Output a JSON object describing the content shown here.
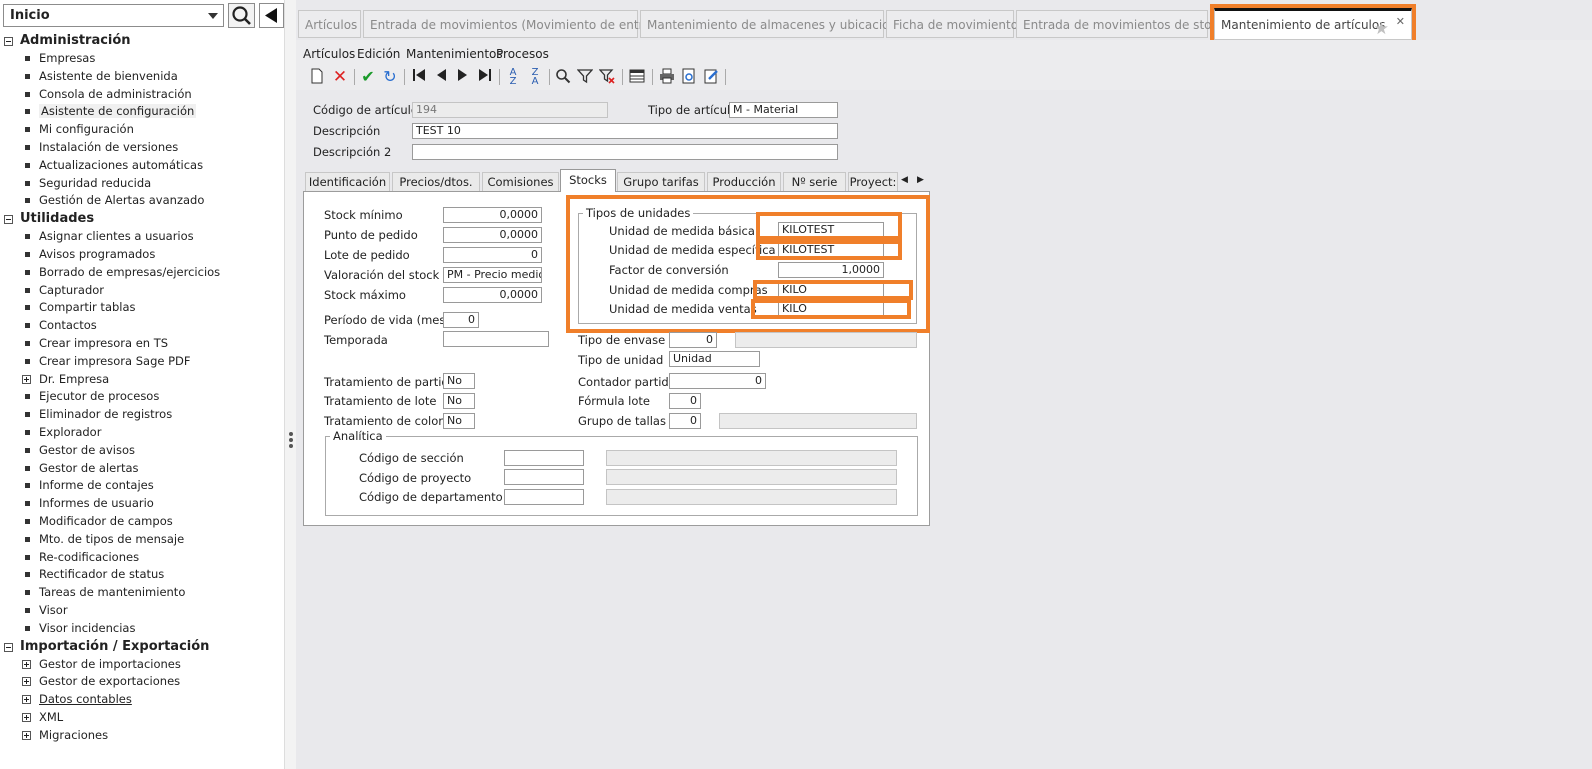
{
  "sidebar": {
    "dropdown": "Inicio",
    "groups": [
      {
        "label": "Administración",
        "items": [
          {
            "label": "Empresas",
            "kind": "bullet"
          },
          {
            "label": "Asistente de bienvenida",
            "kind": "bullet"
          },
          {
            "label": "Consola de administración",
            "kind": "bullet"
          },
          {
            "label": "Asistente de configuración",
            "kind": "bullet",
            "selected": true
          },
          {
            "label": "Mi configuración",
            "kind": "bullet"
          },
          {
            "label": "Instalación de versiones",
            "kind": "bullet"
          },
          {
            "label": "Actualizaciones automáticas",
            "kind": "bullet"
          },
          {
            "label": "Seguridad reducida",
            "kind": "bullet"
          },
          {
            "label": "Gestión de Alertas avanzado",
            "kind": "bullet"
          }
        ]
      },
      {
        "label": "Utilidades",
        "items": [
          {
            "label": "Asignar clientes a usuarios",
            "kind": "bullet"
          },
          {
            "label": "Avisos programados",
            "kind": "bullet"
          },
          {
            "label": "Borrado de empresas/ejercicios",
            "kind": "bullet"
          },
          {
            "label": "Capturador",
            "kind": "bullet"
          },
          {
            "label": "Compartir tablas",
            "kind": "bullet"
          },
          {
            "label": "Contactos",
            "kind": "bullet"
          },
          {
            "label": "Crear impresora en TS",
            "kind": "bullet"
          },
          {
            "label": "Crear impresora Sage PDF",
            "kind": "bullet"
          },
          {
            "label": "Dr. Empresa",
            "kind": "plus"
          },
          {
            "label": "Ejecutor de procesos",
            "kind": "bullet"
          },
          {
            "label": "Eliminador de registros",
            "kind": "bullet"
          },
          {
            "label": "Explorador",
            "kind": "bullet"
          },
          {
            "label": "Gestor de avisos",
            "kind": "bullet"
          },
          {
            "label": "Gestor de alertas",
            "kind": "bullet"
          },
          {
            "label": "Informe de contajes",
            "kind": "bullet"
          },
          {
            "label": "Informes de usuario",
            "kind": "bullet"
          },
          {
            "label": "Modificador de campos",
            "kind": "bullet"
          },
          {
            "label": "Mto. de tipos de mensaje",
            "kind": "bullet"
          },
          {
            "label": "Re-codificaciones",
            "kind": "bullet"
          },
          {
            "label": "Rectificador de status",
            "kind": "bullet"
          },
          {
            "label": "Tareas de mantenimiento",
            "kind": "bullet"
          },
          {
            "label": "Visor",
            "kind": "bullet"
          },
          {
            "label": "Visor incidencias",
            "kind": "bullet"
          }
        ]
      },
      {
        "label": "Importación / Exportación",
        "items": [
          {
            "label": "Gestor de importaciones",
            "kind": "plus"
          },
          {
            "label": "Gestor de exportaciones",
            "kind": "plus"
          },
          {
            "label": "Datos contables",
            "kind": "plus",
            "underline": true
          },
          {
            "label": "XML",
            "kind": "plus"
          },
          {
            "label": "Migraciones",
            "kind": "plus"
          }
        ]
      }
    ]
  },
  "doc_tabs": [
    "Artículos",
    "Entrada de movimientos (Movimiento de entrada)",
    "Mantenimiento de almacenes y ubicaciones",
    "Ficha de movimientos",
    "Entrada de movimientos de stock",
    "Mantenimiento de artículos"
  ],
  "menu": [
    "Artículos",
    "Edición",
    "Mantenimientos",
    "Procesos"
  ],
  "header": {
    "codigo_label": "Código de artículo",
    "codigo_value": "194",
    "tipo_label": "Tipo de artículo",
    "tipo_value": "M  - Material",
    "desc_label": "Descripción",
    "desc_value": "TEST 10",
    "desc2_label": "Descripción 2",
    "desc2_value": ""
  },
  "inner_tabs": [
    "Identificación",
    "Precios/dtos.",
    "Comisiones",
    "Stocks",
    "Grupo tarifas",
    "Producción",
    "Nº serie",
    "Proyect:"
  ],
  "stocks": {
    "stock_minimo": {
      "label": "Stock mínimo",
      "value": "0,0000"
    },
    "punto_pedido": {
      "label": "Punto de pedido",
      "value": "0,0000"
    },
    "lote_pedido": {
      "label": "Lote de pedido",
      "value": "0"
    },
    "valoracion": {
      "label": "Valoración del stock",
      "value": "PM  - Precio medio"
    },
    "stock_maximo": {
      "label": "Stock máximo",
      "value": "0,0000"
    },
    "periodo_vida": {
      "label": "Período de vida (meses)",
      "value": "0"
    },
    "temporada": {
      "label": "Temporada",
      "value": ""
    },
    "trat_partidas": {
      "label": "Tratamiento de partidas",
      "value": "No"
    },
    "trat_lote": {
      "label": "Tratamiento de lote",
      "value": "No"
    },
    "trat_colores": {
      "label": "Tratamiento de colores",
      "value": "No"
    },
    "unidades": {
      "title": "Tipos de unidades",
      "basica": {
        "label": "Unidad de medida básica",
        "value": "KILOTEST"
      },
      "especifica": {
        "label": "Unidad de medida específica",
        "value": "KILOTEST"
      },
      "factor": {
        "label": "Factor de conversión",
        "value": "1,0000"
      },
      "compras": {
        "label": "Unidad de medida compras",
        "value": "KILO"
      },
      "ventas": {
        "label": "Unidad de medida ventas",
        "value": "KILO"
      }
    },
    "tipo_envase": {
      "label": "Tipo de envase",
      "value": "0"
    },
    "tipo_unidad": {
      "label": "Tipo de unidad",
      "value": "Unidad"
    },
    "contador_partida": {
      "label": "Contador partida",
      "value": "0"
    },
    "formula_lote": {
      "label": "Fórmula lote",
      "value": "0"
    },
    "grupo_tallas": {
      "label": "Grupo de tallas",
      "value": "0"
    },
    "analitica": {
      "title": "Analítica",
      "seccion": {
        "label": "Código de sección",
        "value": ""
      },
      "proyecto": {
        "label": "Código de  proyecto",
        "value": ""
      },
      "departamento": {
        "label": "Código de  departamento",
        "value": ""
      }
    }
  },
  "colors": {
    "highlight": "#f07f2a",
    "background": "#e9e9ec"
  }
}
